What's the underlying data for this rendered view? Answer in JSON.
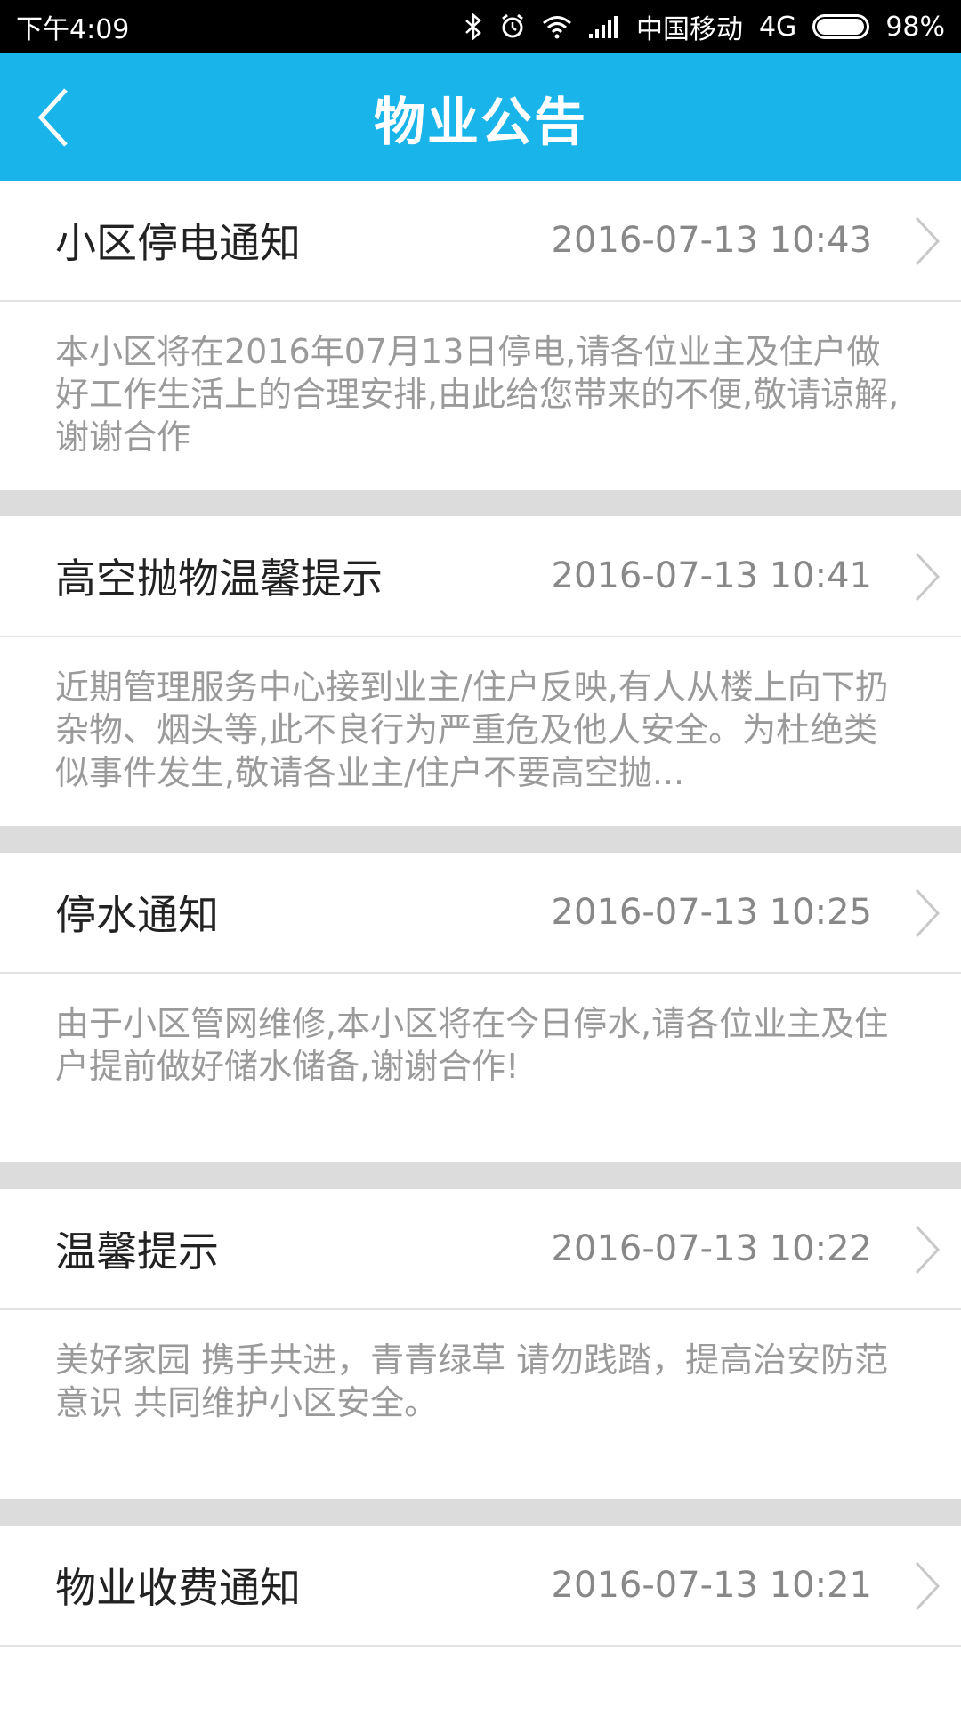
{
  "status": {
    "time": "下午4:09",
    "carrier": "中国移动",
    "network": "4G",
    "battery": "98%",
    "icons": [
      "bluetooth-icon",
      "alarm-icon",
      "wifi-icon",
      "signal-icon",
      "battery-icon"
    ]
  },
  "header": {
    "title": "物业公告",
    "back_icon": "chevron-left-icon",
    "color": "#19b4ea"
  },
  "notices": [
    {
      "title": "小区停电通知",
      "time": "2016-07-13 10:43",
      "content": "本小区将在2016年07月13日停电,请各位业主及住户做好工作生活上的合理安排,由此给您带来的不便,敬请谅解,谢谢合作"
    },
    {
      "title": "高空抛物温馨提示",
      "time": "2016-07-13 10:41",
      "content": "近期管理服务中心接到业主/住户反映,有人从楼上向下扔杂物、烟头等,此不良行为严重危及他人安全。为杜绝类似事件发生,敬请各业主/住户不要高空抛..."
    },
    {
      "title": "停水通知",
      "time": "2016-07-13 10:25",
      "content": "由于小区管网维修,本小区将在今日停水,请各位业主及住户提前做好储水储备,谢谢合作!"
    },
    {
      "title": "温馨提示",
      "time": "2016-07-13 10:22",
      "content": "美好家园 携手共进，青青绿草 请勿践踏，提高治安防范意识 共同维护小区安全。"
    },
    {
      "title": "物业收费通知",
      "time": "2016-07-13 10:21",
      "content": ""
    }
  ]
}
